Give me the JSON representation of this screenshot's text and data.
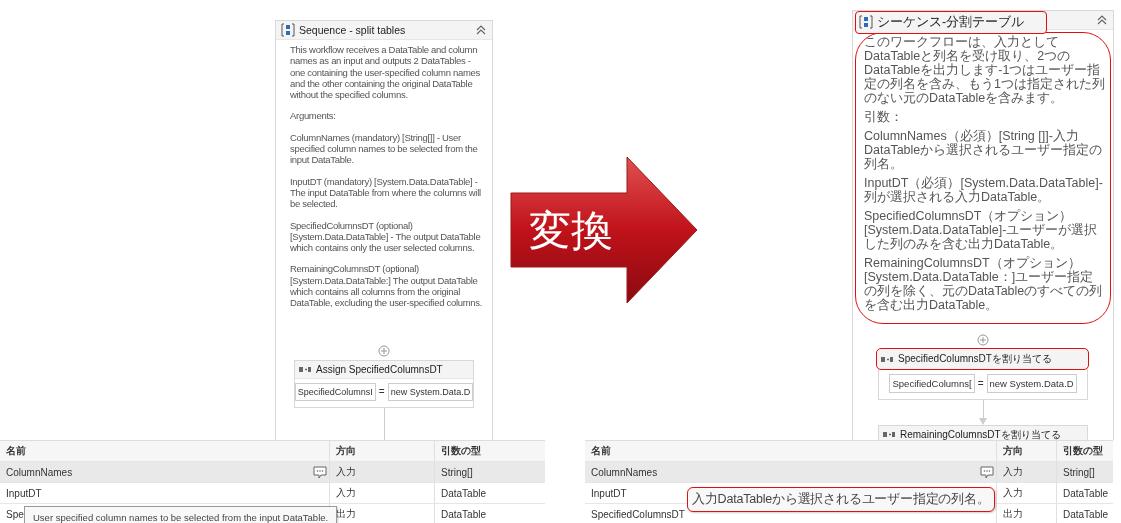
{
  "panels": [
    {
      "sequence": {
        "title": "Sequence - split tables",
        "highlighted": false,
        "highlight_description": false,
        "description": [
          "This workflow receives a DataTable and column names as an input and outputs 2 DataTables - one containing the user-specified column names and the other containing the original DataTable without the specified columns.",
          "Arguments:",
          "ColumnNames (mandatory) [String[]] -  User specified column names to be selected from the input DataTable.",
          "InputDT (mandatory) [System.Data.DataTable] - The input DataTable from where the columns will be selected.",
          "SpecifiedColumnsDT (optional) [System.Data.DataTable] - The output DataTable which contains only the user selected columns.",
          "RemainingColumnsDT (optional) [System.Data.DataTable:] The output DataTable which contains all columns from the original DataTable, excluding the user-specified columns."
        ]
      },
      "activities": [
        {
          "title": "Assign SpecifiedColumnsDT",
          "highlighted": false,
          "to": "SpecifiedColumnsI",
          "operator": "=",
          "value": "new System.Data.D"
        }
      ],
      "arguments": {
        "columns": [
          "名前",
          "方向",
          "引数の型"
        ],
        "rows": [
          {
            "name": "ColumnNames",
            "direction": "入力",
            "type": "String[]",
            "selected": true
          },
          {
            "name": "InputDT",
            "direction": "入力",
            "type": "DataTable",
            "selected": false
          },
          {
            "name": "Spe",
            "direction": "出力",
            "type": "DataTable",
            "selected": false
          }
        ],
        "tooltip": {
          "text": "User specified column names to be selected from the input DataTable.",
          "highlighted": false
        }
      }
    },
    {
      "sequence": {
        "title": "シーケンス-分割テーブル",
        "highlighted": true,
        "highlight_description": true,
        "description": [
          "このワークフローは、入力としてDataTableと列名を受け取り、2つのDataTableを出力します-1つはユーザー指定の列名を含み、もう1つは指定された列のない元のDataTableを含みます。",
          "引数：",
          "ColumnNames（必須）[String []]-入力DataTableから選択されるユーザー指定の列名。",
          "InputDT（必須）[System.Data.DataTable]-列が選択される入力DataTable。",
          "SpecifiedColumnsDT（オプション）[System.Data.DataTable]-ユーザーが選択した列のみを含む出力DataTable。",
          "RemainingColumnsDT（オプション）[System.Data.DataTable：]ユーザー指定の列を除く、元のDataTableのすべての列を含む出力DataTable。"
        ]
      },
      "activities": [
        {
          "title": "SpecifiedColumnsDTを割り当てる",
          "highlighted": true,
          "to": "SpecifiedColumns[",
          "operator": "=",
          "value": "new System.Data.D"
        },
        {
          "title": "RemainingColumnsDTを割り当てる",
          "highlighted": false
        }
      ],
      "arguments": {
        "columns": [
          "名前",
          "方向",
          "引数の型"
        ],
        "rows": [
          {
            "name": "ColumnNames",
            "direction": "入力",
            "type": "String[]",
            "selected": true
          },
          {
            "name": "InputDT",
            "direction": "入力",
            "type": "DataTable",
            "selected": false
          },
          {
            "name": "SpecifiedColumnsDT",
            "direction": "出力",
            "type": "DataTable",
            "selected": false
          }
        ],
        "tooltip": {
          "text": "入力DataTableから選択されるユーザー指定の列名。",
          "highlighted": true
        }
      }
    }
  ],
  "arrow_label": "変換"
}
